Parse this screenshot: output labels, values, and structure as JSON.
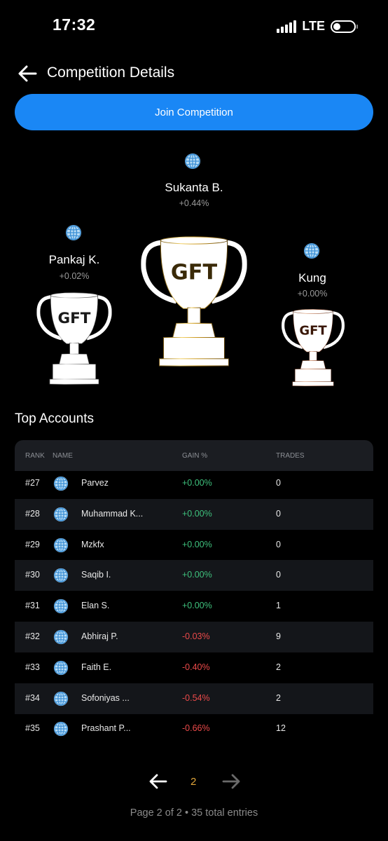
{
  "status": {
    "time": "17:32",
    "network": "LTE"
  },
  "header": {
    "title": "Competition Details"
  },
  "join_label": "Join Competition",
  "podium": {
    "first": {
      "name": "Sukanta B.",
      "gain": "+0.44%"
    },
    "second": {
      "name": "Pankaj K.",
      "gain": "+0.02%"
    },
    "third": {
      "name": "Kung",
      "gain": "+0.00%"
    },
    "trophy_logo_text": "GFT"
  },
  "top_accounts": {
    "title": "Top Accounts",
    "columns": {
      "rank": "RANK",
      "name": "NAME",
      "gain": "GAIN %",
      "trades": "TRADES"
    },
    "rows": [
      {
        "rank": "#27",
        "name": "Parvez",
        "gain": "+0.00%",
        "trades": "0",
        "sign": "pos"
      },
      {
        "rank": "#28",
        "name": "Muhammad K...",
        "gain": "+0.00%",
        "trades": "0",
        "sign": "pos"
      },
      {
        "rank": "#29",
        "name": "Mzkfx",
        "gain": "+0.00%",
        "trades": "0",
        "sign": "pos"
      },
      {
        "rank": "#30",
        "name": "Saqib I.",
        "gain": "+0.00%",
        "trades": "0",
        "sign": "pos"
      },
      {
        "rank": "#31",
        "name": "Elan S.",
        "gain": "+0.00%",
        "trades": "1",
        "sign": "pos"
      },
      {
        "rank": "#32",
        "name": "Abhiraj P.",
        "gain": "-0.03%",
        "trades": "9",
        "sign": "neg"
      },
      {
        "rank": "#33",
        "name": "Faith E.",
        "gain": "-0.40%",
        "trades": "2",
        "sign": "neg"
      },
      {
        "rank": "#34",
        "name": "Sofoniyas ...",
        "gain": "-0.54%",
        "trades": "2",
        "sign": "neg"
      },
      {
        "rank": "#35",
        "name": "Prashant P...",
        "gain": "-0.66%",
        "trades": "12",
        "sign": "neg"
      }
    ]
  },
  "pagination": {
    "current": "2",
    "info": "Page 2 of 2 • 35 total entries"
  },
  "colors": {
    "accent": "#1a87f5",
    "positive": "#3ec07c",
    "negative": "#ec4a4a",
    "page_active": "#e0a53a"
  },
  "icons": [
    "back-arrow-icon",
    "globe-icon",
    "trophy-gold-icon",
    "trophy-silver-icon",
    "trophy-bronze-icon",
    "arrow-left-icon",
    "arrow-right-icon"
  ]
}
